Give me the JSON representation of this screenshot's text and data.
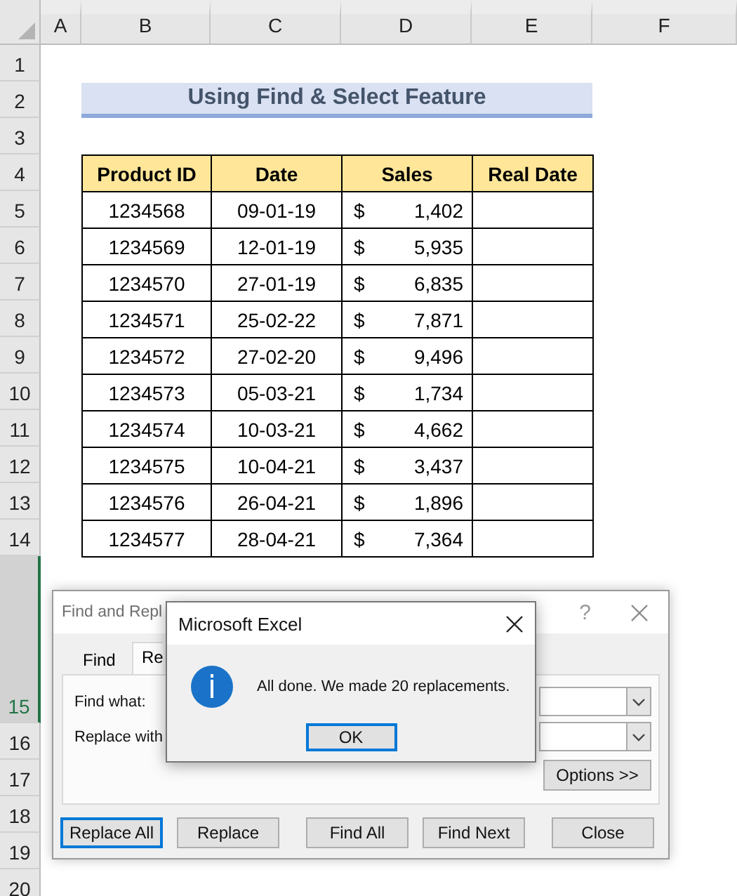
{
  "sheet": {
    "column_headers": [
      {
        "label": "A"
      },
      {
        "label": "B"
      },
      {
        "label": "C"
      },
      {
        "label": "D"
      },
      {
        "label": "E"
      },
      {
        "label": "F"
      }
    ],
    "row_headers": [
      {
        "label": "1",
        "selected": false
      },
      {
        "label": "2",
        "selected": false
      },
      {
        "label": "3",
        "selected": false
      },
      {
        "label": "4",
        "selected": false
      },
      {
        "label": "5",
        "selected": false
      },
      {
        "label": "6",
        "selected": false
      },
      {
        "label": "7",
        "selected": false
      },
      {
        "label": "8",
        "selected": false
      },
      {
        "label": "9",
        "selected": false
      },
      {
        "label": "10",
        "selected": false
      },
      {
        "label": "11",
        "selected": false
      },
      {
        "label": "12",
        "selected": false
      },
      {
        "label": "13",
        "selected": false
      },
      {
        "label": "14",
        "selected": false
      },
      {
        "label": "15",
        "selected": true
      },
      {
        "label": "16",
        "selected": false
      },
      {
        "label": "17",
        "selected": false
      },
      {
        "label": "18",
        "selected": false
      },
      {
        "label": "19",
        "selected": false
      },
      {
        "label": "20",
        "selected": false
      }
    ]
  },
  "title": "Using Find & Select Feature",
  "table": {
    "columns": [
      "Product ID",
      "Date",
      "Sales",
      "Real Date"
    ],
    "rows": [
      {
        "product_id": "1234568",
        "date": "09-01-19",
        "currency": "$",
        "sales": "1,402"
      },
      {
        "product_id": "1234569",
        "date": "12-01-19",
        "currency": "$",
        "sales": "5,935"
      },
      {
        "product_id": "1234570",
        "date": "27-01-19",
        "currency": "$",
        "sales": "6,835"
      },
      {
        "product_id": "1234571",
        "date": "25-02-22",
        "currency": "$",
        "sales": "7,871"
      },
      {
        "product_id": "1234572",
        "date": "27-02-20",
        "currency": "$",
        "sales": "9,496"
      },
      {
        "product_id": "1234573",
        "date": "05-03-21",
        "currency": "$",
        "sales": "1,734"
      },
      {
        "product_id": "1234574",
        "date": "10-03-21",
        "currency": "$",
        "sales": "4,662"
      },
      {
        "product_id": "1234575",
        "date": "10-04-21",
        "currency": "$",
        "sales": "3,437"
      },
      {
        "product_id": "1234576",
        "date": "26-04-21",
        "currency": "$",
        "sales": "1,896"
      },
      {
        "product_id": "1234577",
        "date": "28-04-21",
        "currency": "$",
        "sales": "7,364"
      }
    ]
  },
  "find_replace_dialog": {
    "title": "Find and Repl",
    "help": "?",
    "tabs": [
      {
        "label": "Find",
        "selected": false
      },
      {
        "label": "Re",
        "selected": true
      }
    ],
    "fields": [
      {
        "label": "Find what:"
      },
      {
        "label": "Replace with"
      }
    ],
    "options_button": "Options >>",
    "buttons": [
      {
        "label": "Replace All",
        "focused": true
      },
      {
        "label": "Replace",
        "focused": false
      },
      {
        "label": "Find All",
        "focused": false
      },
      {
        "label": "Find Next",
        "focused": false
      },
      {
        "label": "Close",
        "focused": false
      }
    ]
  },
  "message_box": {
    "title": "Microsoft Excel",
    "message": "All done. We made 20 replacements.",
    "ok_button": "OK"
  }
}
